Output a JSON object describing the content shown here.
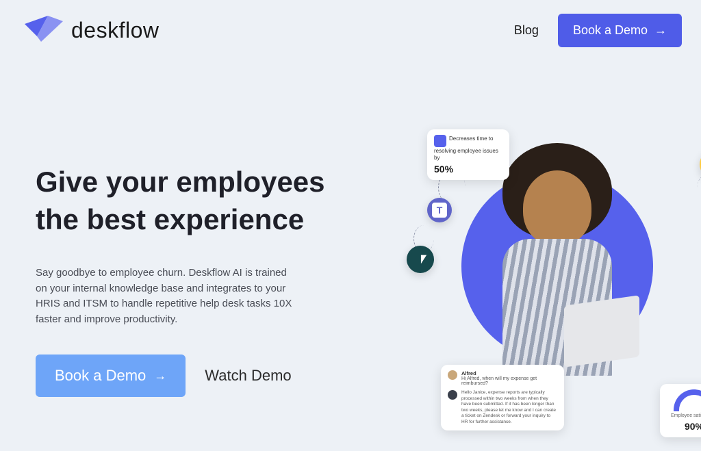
{
  "header": {
    "brand": "deskflow",
    "blog": "Blog",
    "cta": "Book a Demo"
  },
  "hero": {
    "title": "Give your employees the best experience",
    "description": "Say goodbye to employee churn. Deskflow AI is trained on your internal knowledge base and integrates to your HRIS and ITSM to handle repetitive help desk tasks 10X faster and improve productivity.",
    "cta": "Book a Demo",
    "watch": "Watch Demo"
  },
  "cards": {
    "resolve": {
      "text": "Decreases time to resolving employee issues by",
      "value": "50%"
    },
    "chat": {
      "title": "Alfred",
      "question": "Hi Alfred, when will my expense get reimbursed?",
      "reply": "Hello Janice, expense reports are typically processed within two weeks from when they have been submitted. If it has been longer than two weeks, please let me know and I can create a ticket on Zendesk or forward your inquiry to HR for further assistance."
    },
    "satisfaction": {
      "label": "Employee satisfaction",
      "value": "90%"
    }
  },
  "badges": {
    "teams": "T",
    "zendesk": "z",
    "monday": "ጢ",
    "slack": "✦"
  }
}
